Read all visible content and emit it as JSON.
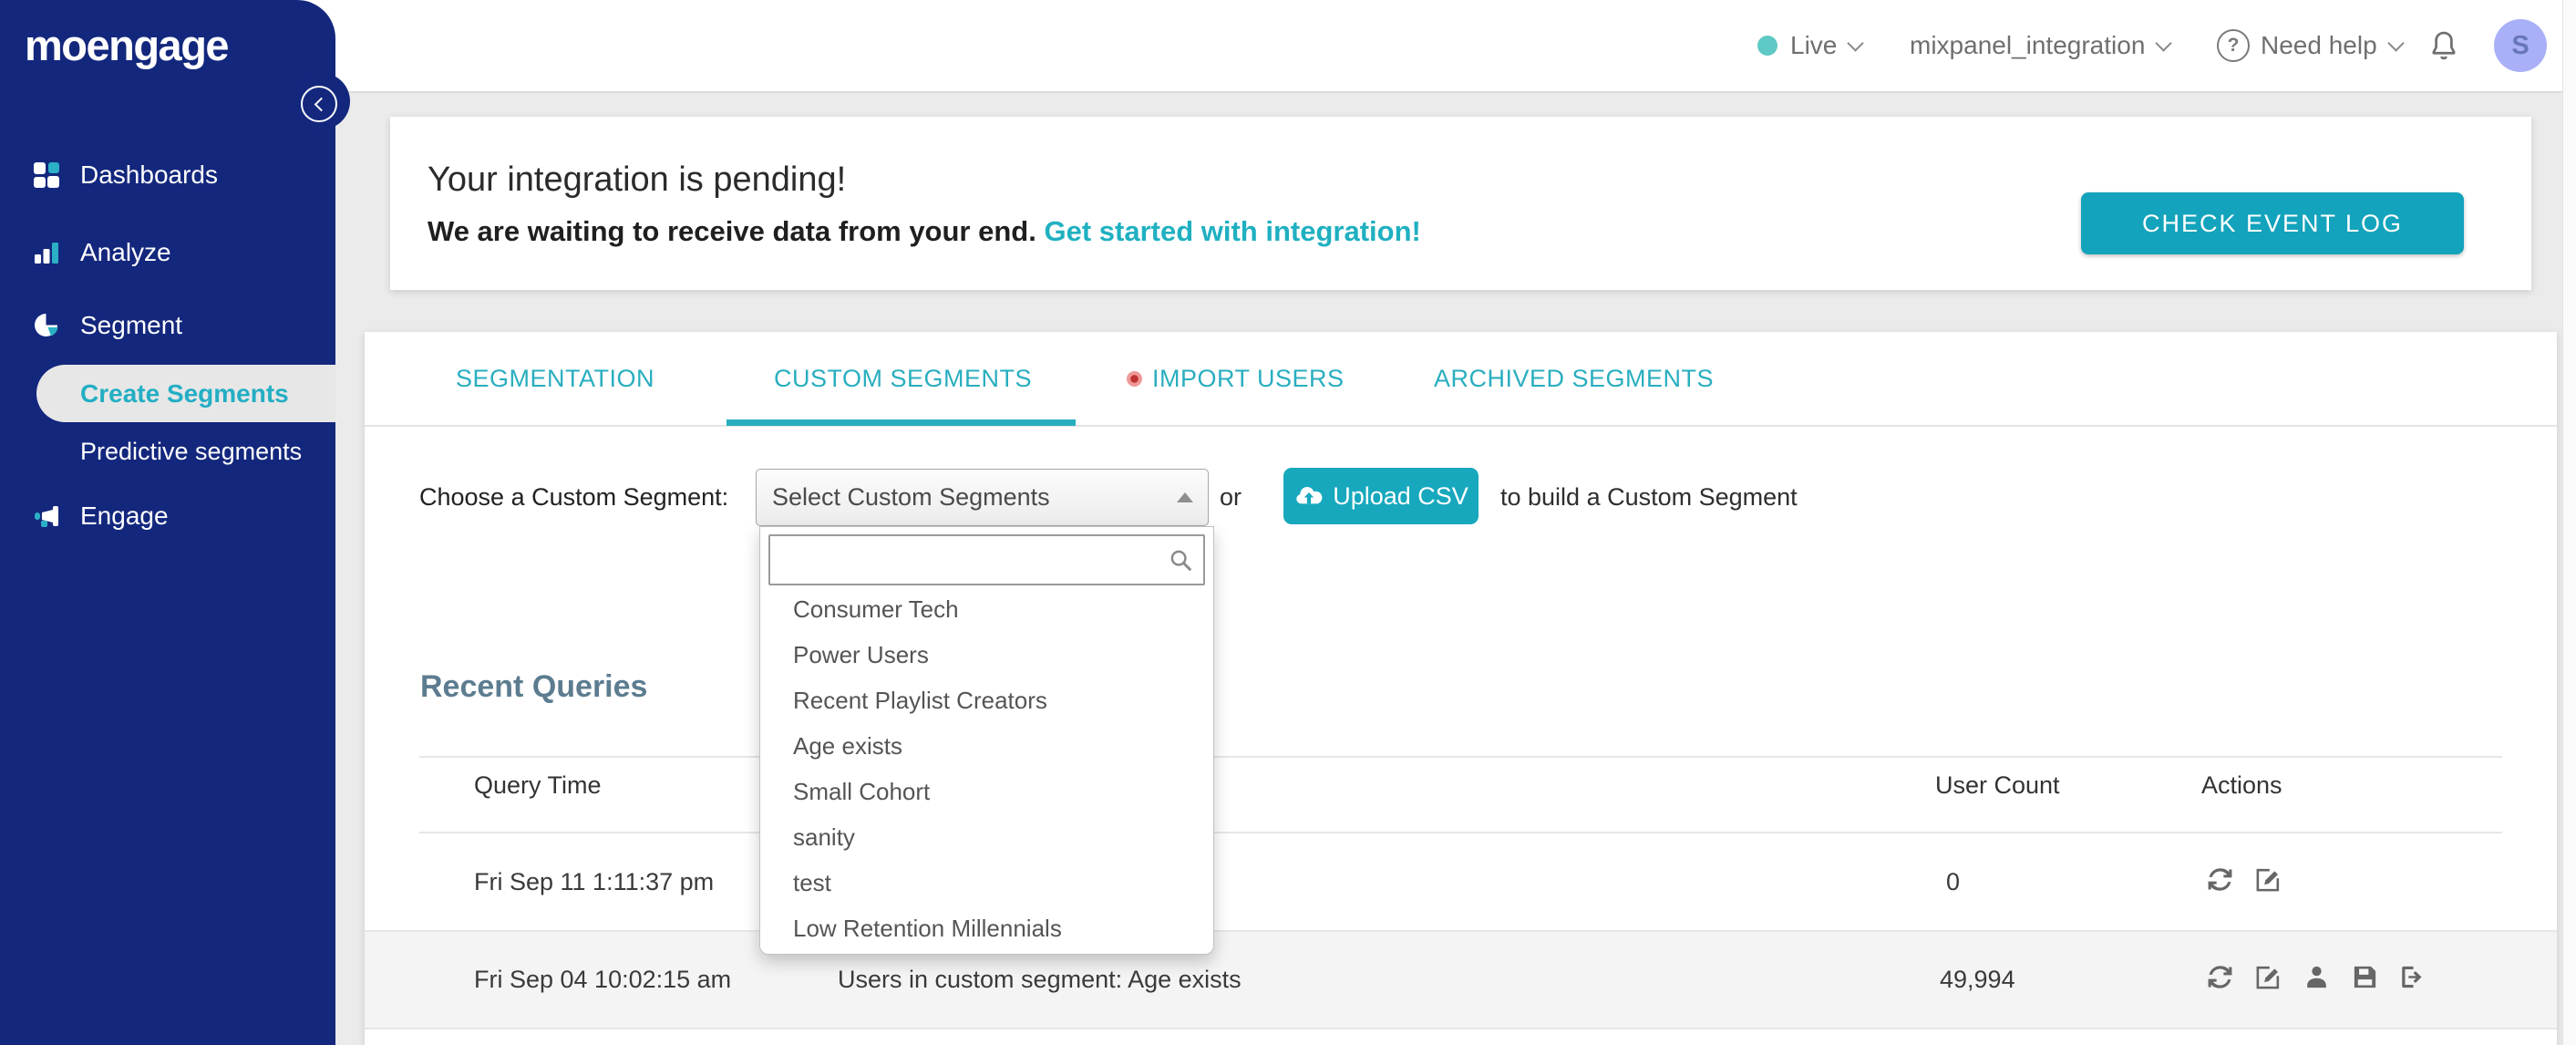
{
  "sidebar": {
    "logo_text": "moengage",
    "items": [
      {
        "label": "Dashboards"
      },
      {
        "label": "Analyze"
      },
      {
        "label": "Segment"
      },
      {
        "label": "Create Segments"
      },
      {
        "label": "Predictive segments"
      },
      {
        "label": "Engage"
      }
    ]
  },
  "header": {
    "env_label": "Live",
    "workspace_name": "mixpanel_integration",
    "help_label": "Need help",
    "avatar_initial": "S"
  },
  "banner": {
    "title": "Your integration is pending!",
    "subtitle": "We are waiting to receive data from your end.",
    "link_label": "Get started with integration!",
    "button_label": "CHECK EVENT LOG"
  },
  "tabs": [
    {
      "label": "SEGMENTATION",
      "active": false
    },
    {
      "label": "CUSTOM SEGMENTS",
      "active": true
    },
    {
      "label": "IMPORT USERS",
      "active": false
    },
    {
      "label": "ARCHIVED SEGMENTS",
      "active": false
    }
  ],
  "segment_picker": {
    "label": "Choose a Custom Segment:",
    "select_value": "Select Custom Segments",
    "or_text": "or",
    "upload_button_label": "Upload CSV",
    "suffix_text": "to build a Custom Segment",
    "search_value": "",
    "options": [
      "Consumer Tech",
      "Power Users",
      "Recent Playlist Creators",
      "Age exists",
      "Small Cohort",
      "sanity",
      "test",
      "Low Retention Millennials"
    ]
  },
  "recent_queries": {
    "title": "Recent Queries",
    "columns": {
      "query_time": "Query Time",
      "user_count": "User Count",
      "actions": "Actions"
    },
    "rows": [
      {
        "query_time": "Fri Sep 11 1:11:37 pm",
        "query_info": "",
        "user_count": "0"
      },
      {
        "query_time": "Fri Sep 04 10:02:15 am",
        "query_info": "Users in custom segment: Age exists",
        "user_count": "49,994"
      }
    ]
  },
  "colors": {
    "sidebar_navy": "#13277D",
    "teal_accent": "#29AEBF",
    "teal_button": "#17A8BE",
    "import_alert_red": "#E2574C",
    "live_dot_teal": "#5FC9C5",
    "avatar_bg": "#A9B0F8",
    "recent_queries_heading": "#5D7C90"
  }
}
